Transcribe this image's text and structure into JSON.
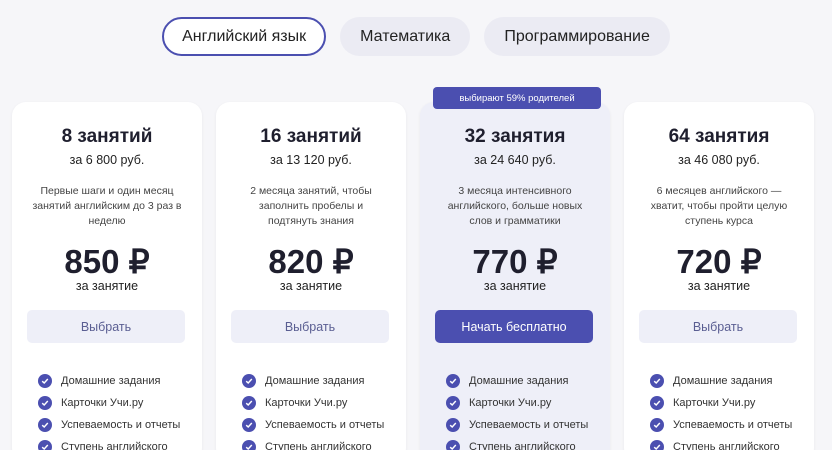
{
  "tabs": [
    {
      "label": "Английский язык",
      "active": true
    },
    {
      "label": "Математика",
      "active": false
    },
    {
      "label": "Программирование",
      "active": false
    }
  ],
  "accent_color": "#4b4fb0",
  "plans": [
    {
      "title": "8 занятий",
      "subtitle": "за 6 800 руб.",
      "description": "Первые шаги и один месяц занятий английским до 3 раз в неделю",
      "price": "850 ₽",
      "price_unit": "за занятие",
      "button": "Выбрать",
      "features": [
        "Домашние задания",
        "Карточки Учи.ру",
        "Успеваемость и отчеты",
        "Ступень английского"
      ]
    },
    {
      "title": "16 занятий",
      "subtitle": "за 13 120 руб.",
      "description": "2 месяца занятий, чтобы заполнить пробелы и подтянуть знания",
      "price": "820 ₽",
      "price_unit": "за занятие",
      "button": "Выбрать",
      "features": [
        "Домашние задания",
        "Карточки Учи.ру",
        "Успеваемость и отчеты",
        "Ступень английского"
      ]
    },
    {
      "badge": "выбирают 59% родителей",
      "title": "32 занятия",
      "subtitle": "за 24 640 руб.",
      "description": "3 месяца интенсивного английского, больше новых слов и грамматики",
      "price": "770 ₽",
      "price_unit": "за занятие",
      "button": "Начать бесплатно",
      "features": [
        "Домашние задания",
        "Карточки Учи.ру",
        "Успеваемость и отчеты",
        "Ступень английского"
      ]
    },
    {
      "title": "64 занятия",
      "subtitle": "за 46 080 руб.",
      "description": "6 месяцев английского — хватит, чтобы пройти целую ступень курса",
      "price": "720 ₽",
      "price_unit": "за занятие",
      "button": "Выбрать",
      "features": [
        "Домашние задания",
        "Карточки Учи.ру",
        "Успеваемость и отчеты",
        "Ступень английского"
      ]
    }
  ]
}
